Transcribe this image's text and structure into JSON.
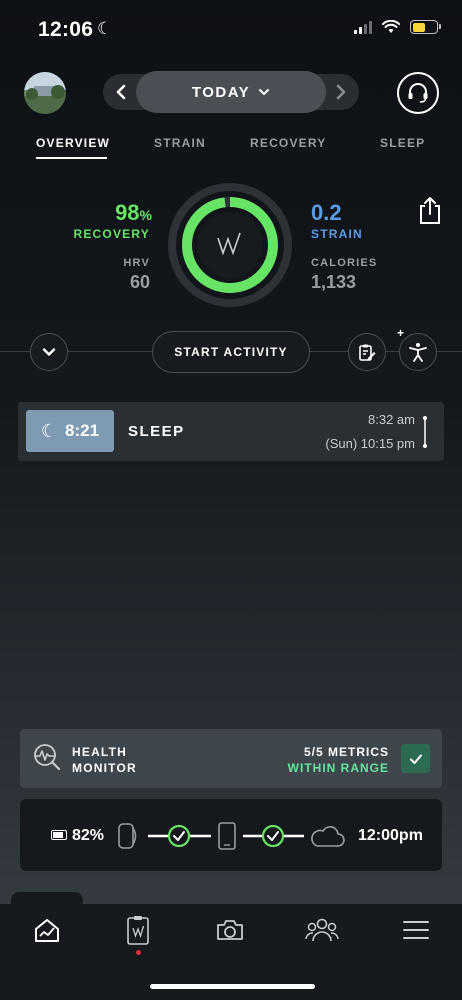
{
  "status_bar": {
    "time": "12:06"
  },
  "header": {
    "day_label": "TODAY",
    "prev_arrow": "‹",
    "next_arrow": "›"
  },
  "tabs": [
    {
      "label": "OVERVIEW",
      "active": true
    },
    {
      "label": "STRAIN",
      "active": false
    },
    {
      "label": "RECOVERY",
      "active": false
    },
    {
      "label": "SLEEP",
      "active": false
    }
  ],
  "scores": {
    "recovery_value": "98",
    "recovery_unit": "%",
    "recovery_label": "RECOVERY",
    "recovery_fraction": 0.98,
    "hrv_label": "HRV",
    "hrv_value": "60",
    "strain_value": "0.2",
    "strain_label": "STRAIN",
    "calories_label": "CALORIES",
    "calories_value": "1,133",
    "colors": {
      "recovery": "#67e365",
      "strain": "#5a9be6"
    }
  },
  "actions": {
    "start_activity": "START ACTIVITY"
  },
  "sleep": {
    "duration": "8:21",
    "title": "SLEEP",
    "end_time": "8:32 am",
    "start_time": "(Sun) 10:15 pm"
  },
  "health_monitor": {
    "line1": "HEALTH",
    "line2": "MONITOR",
    "metrics": "5/5 METRICS",
    "range": "WITHIN RANGE"
  },
  "device": {
    "battery": "82%",
    "sync_time": "12:00pm"
  },
  "icons": {
    "nav": [
      "home-icon",
      "journal-icon",
      "camera-icon",
      "community-icon",
      "menu-icon"
    ]
  }
}
